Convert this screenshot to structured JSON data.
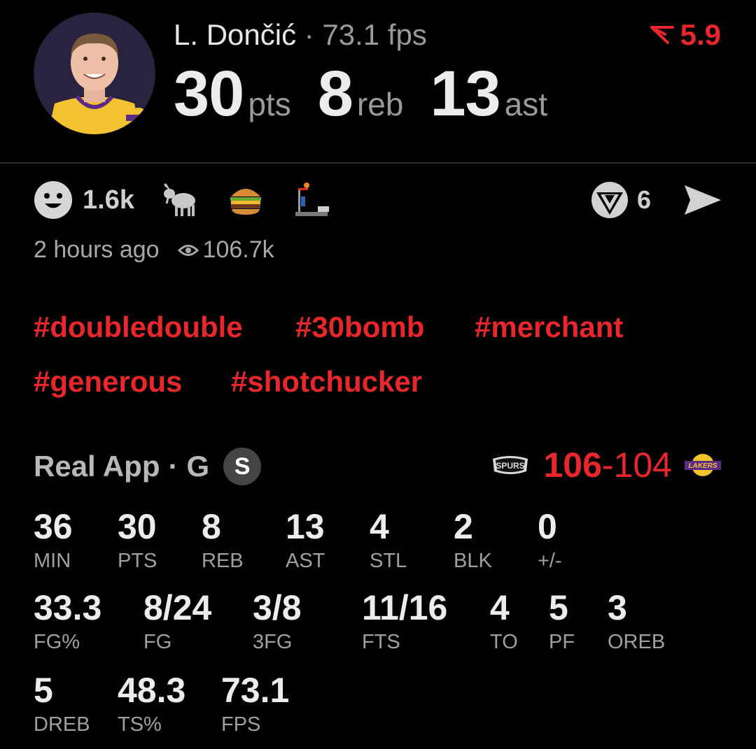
{
  "player": {
    "name": "L. Dončić",
    "separator": "·",
    "fps_text": "73.1 fps",
    "pts": "30",
    "pts_unit": "pts",
    "reb": "8",
    "reb_unit": "reb",
    "ast": "13",
    "ast_unit": "ast"
  },
  "rating": {
    "value": "5.9",
    "icon": "down-pennant-icon",
    "color": "#e8262b"
  },
  "reactions": {
    "smiley_count": "1.6k",
    "emojis": [
      "goat-emoji",
      "burger-emoji",
      "dunk-emoji"
    ],
    "comments_count": "6"
  },
  "meta": {
    "time_ago": "2 hours ago",
    "views": "106.7k"
  },
  "tags": [
    "#doubledouble",
    "#30bomb",
    "#merchant",
    "#generous",
    "#shotchucker"
  ],
  "game": {
    "source": "Real App",
    "separator": "·",
    "position": "G",
    "starter_badge": "S",
    "home_score": "106",
    "dash": "-",
    "away_score": "104",
    "home_team": "SPURS",
    "away_team": "LAKERS"
  },
  "stats": [
    {
      "value": "36",
      "label": "MIN"
    },
    {
      "value": "30",
      "label": "PTS"
    },
    {
      "value": "8",
      "label": "REB"
    },
    {
      "value": "13",
      "label": "AST"
    },
    {
      "value": "4",
      "label": "STL"
    },
    {
      "value": "2",
      "label": "BLK"
    },
    {
      "value": "0",
      "label": "+/-"
    },
    {
      "value": "33.3",
      "label": "FG%"
    },
    {
      "value": "8/24",
      "label": "FG"
    },
    {
      "value": "3/8",
      "label": "3FG"
    },
    {
      "value": "11/16",
      "label": "FTS"
    },
    {
      "value": "4",
      "label": "TO"
    },
    {
      "value": "5",
      "label": "PF"
    },
    {
      "value": "3",
      "label": "OREB"
    },
    {
      "value": "5",
      "label": "DREB"
    },
    {
      "value": "48.3",
      "label": "TS%"
    },
    {
      "value": "73.1",
      "label": "FPS"
    }
  ]
}
